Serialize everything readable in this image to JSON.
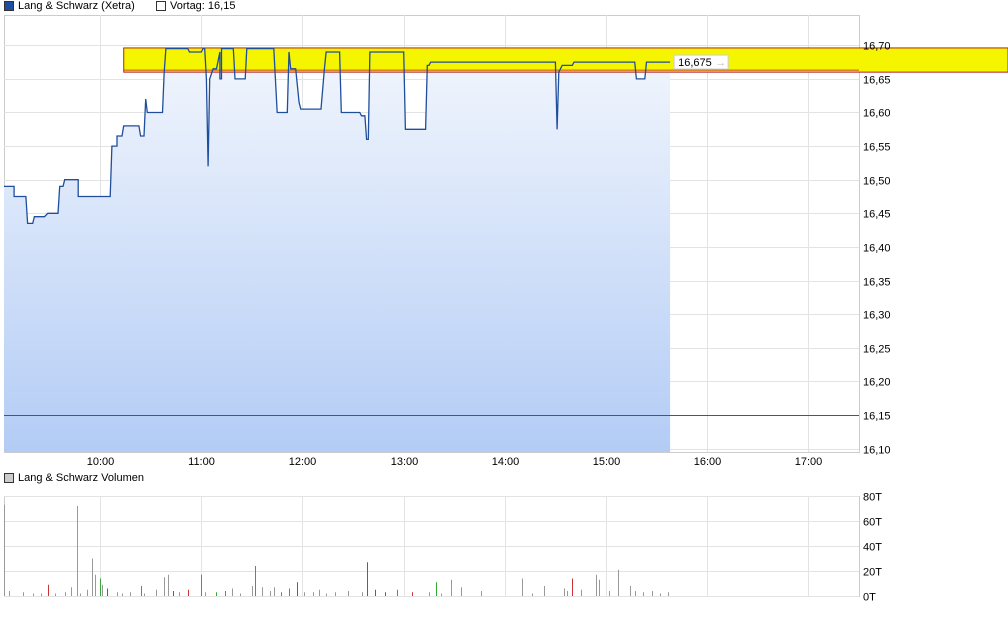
{
  "price_chart": {
    "legend": {
      "series_label": "Lang & Schwarz (Xetra)",
      "series_color": "#1f4e9c",
      "prev_close_label": "Vortag: 16,15"
    },
    "last_value_label": "16,675",
    "highlight_band_color": "#f5f500",
    "prev_close_line_color": "#555555",
    "area_fill_top": "#f2f6fd",
    "area_fill_bottom": "#b3ccf5"
  },
  "volume_chart": {
    "legend": {
      "series_label": "Lang & Schwarz Volumen",
      "swatch_color": "#cccccc"
    }
  },
  "chart_data": [
    {
      "type": "line",
      "title": "",
      "series": [
        {
          "name": "Lang & Schwarz (Xetra)"
        }
      ],
      "x_ticks": [
        "10:00",
        "11:00",
        "12:00",
        "13:00",
        "14:00",
        "15:00",
        "16:00",
        "17:00"
      ],
      "y_ticks": [
        "16,70",
        "16,65",
        "16,60",
        "16,55",
        "16,50",
        "16,45",
        "16,40",
        "16,35",
        "16,30",
        "16,25",
        "16,20",
        "16,15",
        "16,10"
      ],
      "ylim": [
        16.095,
        16.745
      ],
      "xlim": [
        "09:03",
        "17:30"
      ],
      "prev_close": 16.15,
      "last_value": 16.675,
      "highlight_band": [
        16.66,
        16.696
      ],
      "grid": true,
      "points": [
        [
          "09:03",
          16.49
        ],
        [
          "09:09",
          16.49
        ],
        [
          "09:09",
          16.475
        ],
        [
          "09:16",
          16.475
        ],
        [
          "09:17",
          16.435
        ],
        [
          "09:20",
          16.435
        ],
        [
          "09:21",
          16.445
        ],
        [
          "09:27",
          16.445
        ],
        [
          "09:29",
          16.45
        ],
        [
          "09:35",
          16.45
        ],
        [
          "09:36",
          16.49
        ],
        [
          "09:38",
          16.49
        ],
        [
          "09:39",
          16.5
        ],
        [
          "09:47",
          16.5
        ],
        [
          "09:47",
          16.475
        ],
        [
          "10:06",
          16.475
        ],
        [
          "10:07",
          16.55
        ],
        [
          "10:10",
          16.55
        ],
        [
          "10:10",
          16.565
        ],
        [
          "10:13",
          16.565
        ],
        [
          "10:14",
          16.58
        ],
        [
          "10:23",
          16.58
        ],
        [
          "10:24",
          16.565
        ],
        [
          "10:26",
          16.565
        ],
        [
          "10:27",
          16.62
        ],
        [
          "10:28",
          16.6
        ],
        [
          "10:37",
          16.6
        ],
        [
          "10:38",
          16.66
        ],
        [
          "10:39",
          16.695
        ],
        [
          "10:52",
          16.695
        ],
        [
          "10:53",
          16.69
        ],
        [
          "11:00",
          16.69
        ],
        [
          "11:01",
          16.695
        ],
        [
          "11:02",
          16.695
        ],
        [
          "11:03",
          16.65
        ],
        [
          "11:04",
          16.52
        ],
        [
          "11:05",
          16.65
        ],
        [
          "11:07",
          16.665
        ],
        [
          "11:09",
          16.665
        ],
        [
          "11:11",
          16.69
        ],
        [
          "11:11",
          16.65
        ],
        [
          "11:12",
          16.65
        ],
        [
          "11:12",
          16.695
        ],
        [
          "11:19",
          16.695
        ],
        [
          "11:20",
          16.65
        ],
        [
          "11:26",
          16.65
        ],
        [
          "11:27",
          16.695
        ],
        [
          "11:43",
          16.695
        ],
        [
          "11:45",
          16.6
        ],
        [
          "11:51",
          16.6
        ],
        [
          "11:52",
          16.69
        ],
        [
          "11:53",
          16.665
        ],
        [
          "11:56",
          16.665
        ],
        [
          "11:58",
          16.615
        ],
        [
          "11:59",
          16.605
        ],
        [
          "12:11",
          16.605
        ],
        [
          "12:13",
          16.665
        ],
        [
          "12:14",
          16.69
        ],
        [
          "12:22",
          16.69
        ],
        [
          "12:23",
          16.6
        ],
        [
          "12:34",
          16.6
        ],
        [
          "12:35",
          16.595
        ],
        [
          "12:37",
          16.595
        ],
        [
          "12:38",
          16.56
        ],
        [
          "12:39",
          16.56
        ],
        [
          "12:40",
          16.69
        ],
        [
          "13:00",
          16.69
        ],
        [
          "13:01",
          16.575
        ],
        [
          "13:13",
          16.575
        ],
        [
          "13:14",
          16.67
        ],
        [
          "13:15",
          16.67
        ],
        [
          "13:16",
          16.675
        ],
        [
          "14:30",
          16.675
        ],
        [
          "14:31",
          16.575
        ],
        [
          "14:32",
          16.66
        ],
        [
          "14:34",
          16.67
        ],
        [
          "14:40",
          16.67
        ],
        [
          "14:41",
          16.675
        ],
        [
          "15:17",
          16.675
        ],
        [
          "15:18",
          16.65
        ],
        [
          "15:23",
          16.65
        ],
        [
          "15:24",
          16.675
        ],
        [
          "15:38",
          16.675
        ]
      ]
    },
    {
      "type": "bar",
      "title": "",
      "series": [
        {
          "name": "Lang & Schwarz Volumen"
        }
      ],
      "y_ticks": [
        "80T",
        "60T",
        "40T",
        "20T",
        "0T"
      ],
      "ylim": [
        0,
        80000
      ],
      "grid": true,
      "bars": [
        [
          "09:03",
          73000,
          "#999999"
        ],
        [
          "09:06",
          4000,
          "#999999"
        ],
        [
          "09:14",
          3000,
          "#999999"
        ],
        [
          "09:20",
          2000,
          "#999999"
        ],
        [
          "09:25",
          2000,
          "#999999"
        ],
        [
          "09:29",
          9000,
          "#cc3333"
        ],
        [
          "09:33",
          2000,
          "#999999"
        ],
        [
          "09:39",
          3000,
          "#999999"
        ],
        [
          "09:43",
          7000,
          "#999999"
        ],
        [
          "09:46",
          72000,
          "#999999"
        ],
        [
          "09:48",
          2000,
          "#999999"
        ],
        [
          "09:52",
          5000,
          "#999999"
        ],
        [
          "09:55",
          30000,
          "#999999"
        ],
        [
          "09:57",
          17000,
          "#999999"
        ],
        [
          "10:00",
          14000,
          "#33aa33"
        ],
        [
          "10:01",
          9000,
          "#999999"
        ],
        [
          "10:04",
          6000,
          "#cc3333"
        ],
        [
          "10:10",
          3000,
          "#999999"
        ],
        [
          "10:13",
          2000,
          "#999999"
        ],
        [
          "10:18",
          3000,
          "#999999"
        ],
        [
          "10:24",
          8000,
          "#33aa33"
        ],
        [
          "10:26",
          2000,
          "#999999"
        ],
        [
          "10:33",
          5000,
          "#999999"
        ],
        [
          "10:38",
          15000,
          "#999999"
        ],
        [
          "10:40",
          17000,
          "#999999"
        ],
        [
          "10:43",
          4000,
          "#cc3333"
        ],
        [
          "10:47",
          3000,
          "#999999"
        ],
        [
          "10:52",
          5000,
          "#cc3333"
        ],
        [
          "11:00",
          17000,
          "#33aa33"
        ],
        [
          "11:02",
          3000,
          "#999999"
        ],
        [
          "11:09",
          3000,
          "#33aa33"
        ],
        [
          "11:14",
          4000,
          "#33aa33"
        ],
        [
          "11:18",
          6000,
          "#999999"
        ],
        [
          "11:23",
          2000,
          "#999999"
        ],
        [
          "11:30",
          8000,
          "#999999"
        ],
        [
          "11:32",
          24000,
          "#33aa33"
        ],
        [
          "11:36",
          7000,
          "#999999"
        ],
        [
          "11:41",
          4000,
          "#999999"
        ],
        [
          "11:43",
          7000,
          "#999999"
        ],
        [
          "11:47",
          3000,
          "#33aa33"
        ],
        [
          "11:52",
          6000,
          "#33aa33"
        ],
        [
          "11:57",
          11000,
          "#cc3333"
        ],
        [
          "12:01",
          3000,
          "#999999"
        ],
        [
          "12:06",
          3000,
          "#999999"
        ],
        [
          "12:10",
          5000,
          "#999999"
        ],
        [
          "12:14",
          2000,
          "#999999"
        ],
        [
          "12:19",
          3000,
          "#999999"
        ],
        [
          "12:27",
          4000,
          "#999999"
        ],
        [
          "12:35",
          3000,
          "#999999"
        ],
        [
          "12:38",
          27000,
          "#cc3333"
        ],
        [
          "12:43",
          5000,
          "#cc3333"
        ],
        [
          "12:49",
          3000,
          "#cc3333"
        ],
        [
          "12:56",
          5000,
          "#33aa33"
        ],
        [
          "13:05",
          3000,
          "#cc3333"
        ],
        [
          "13:15",
          3000,
          "#999999"
        ],
        [
          "13:19",
          11000,
          "#33aa33"
        ],
        [
          "13:22",
          2000,
          "#999999"
        ],
        [
          "13:28",
          13000,
          "#999999"
        ],
        [
          "13:34",
          7000,
          "#999999"
        ],
        [
          "13:46",
          4000,
          "#999999"
        ],
        [
          "14:10",
          14000,
          "#999999"
        ],
        [
          "14:16",
          2000,
          "#999999"
        ],
        [
          "14:23",
          8000,
          "#999999"
        ],
        [
          "14:35",
          6000,
          "#999999"
        ],
        [
          "14:37",
          4000,
          "#999999"
        ],
        [
          "14:40",
          14000,
          "#cc3333"
        ],
        [
          "14:45",
          5000,
          "#999999"
        ],
        [
          "14:54",
          17000,
          "#999999"
        ],
        [
          "14:56",
          13000,
          "#999999"
        ],
        [
          "15:02",
          4000,
          "#999999"
        ],
        [
          "15:07",
          21000,
          "#999999"
        ],
        [
          "15:14",
          8000,
          "#999999"
        ],
        [
          "15:17",
          4000,
          "#999999"
        ],
        [
          "15:22",
          3000,
          "#999999"
        ],
        [
          "15:27",
          4000,
          "#999999"
        ],
        [
          "15:32",
          2000,
          "#999999"
        ],
        [
          "15:37",
          3000,
          "#999999"
        ]
      ]
    }
  ]
}
